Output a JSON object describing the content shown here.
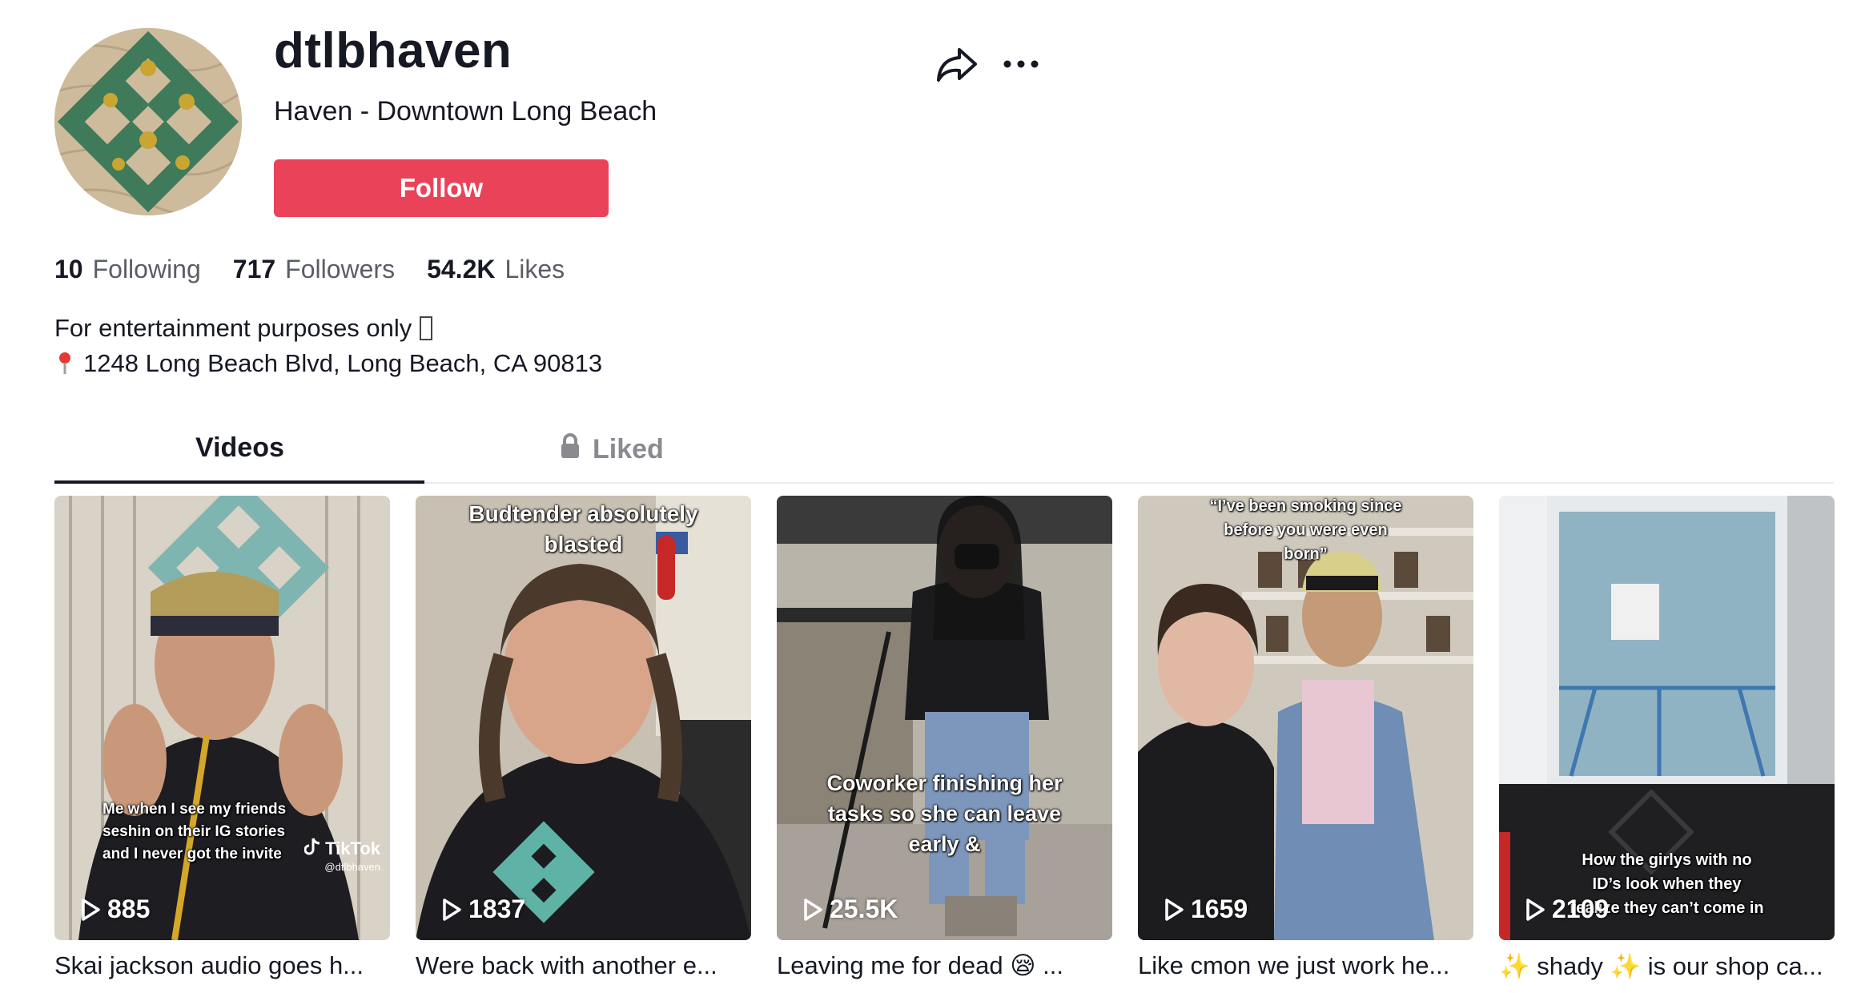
{
  "profile": {
    "username": "dtlbhaven",
    "nickname": "Haven - Downtown Long Beach",
    "follow_label": "Follow",
    "avatar_icon": "haven-logo-avatar",
    "share_icon": "share-icon",
    "more_icon": "more-icon"
  },
  "stats": [
    {
      "value": "10",
      "label": "Following"
    },
    {
      "value": "717",
      "label": "Followers"
    },
    {
      "value": "54.2K",
      "label": "Likes"
    }
  ],
  "bio": {
    "line1": "For entertainment purposes only",
    "line2": "1248 Long Beach Blvd, Long Beach, CA 90813"
  },
  "tabs": [
    {
      "label": "Videos",
      "active": true
    },
    {
      "label": "Liked",
      "active": false,
      "icon": "lock-icon"
    }
  ],
  "videos": [
    {
      "views": "885",
      "title": "Skai jackson audio goes h...",
      "overlay_lines": [
        "Me when I see my friends",
        "seshin on their IG stories",
        "and I never got the invite"
      ],
      "watermark": "TikTok",
      "watermark_handle": "@dtlbhaven"
    },
    {
      "views": "1837",
      "title": "Were back with another e...",
      "overlay_lines": [
        "Budtender absolutely",
        "blasted"
      ]
    },
    {
      "views": "25.5K",
      "title": "Leaving me for dead 😪 ...",
      "overlay_lines": [
        "Coworker finishing her",
        "tasks so she can leave",
        "early &"
      ]
    },
    {
      "views": "1659",
      "title": "Like cmon we just work he...",
      "overlay_lines": [
        "“I’ve been smoking since",
        "before you were even",
        "born”"
      ]
    },
    {
      "views": "2109",
      "title": "✨ shady ✨ is our shop ca...",
      "overlay_lines": [
        "How the girlys with no",
        "ID’s look when they",
        "realize they can’t come in"
      ]
    }
  ],
  "colors": {
    "follow_button": "#ea4359",
    "text_primary": "#161823",
    "text_secondary": "#5b5d66"
  }
}
